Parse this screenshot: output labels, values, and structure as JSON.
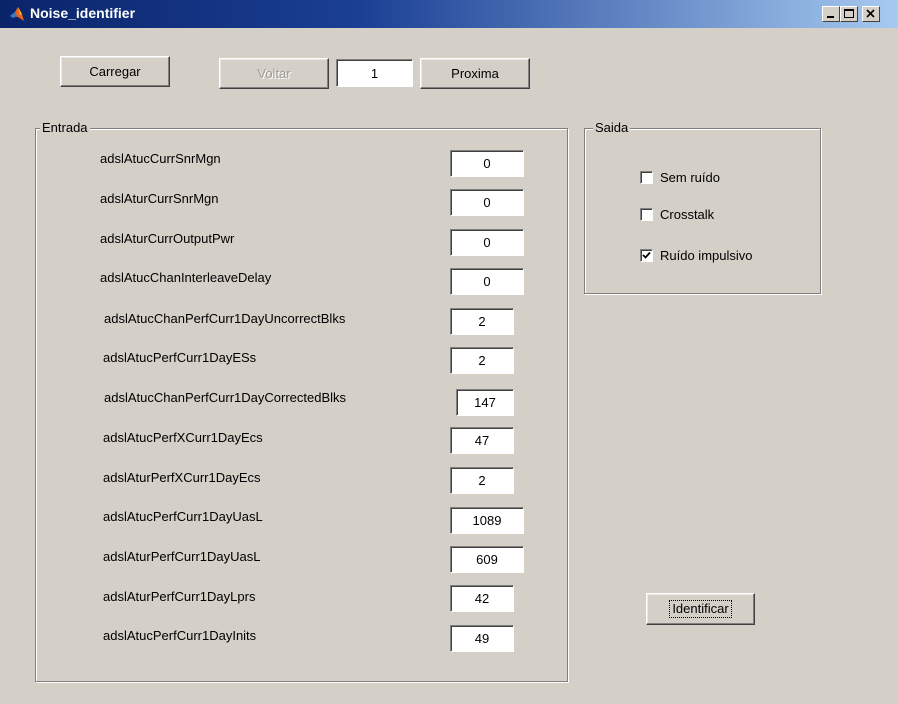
{
  "window": {
    "title": "Noise_identifier",
    "app_icon": "matlab-icon",
    "controls": [
      "minimize-icon",
      "maximize-icon",
      "close-icon"
    ]
  },
  "toolbar": {
    "load_label": "Carregar",
    "back_label": "Voltar",
    "index_value": "1",
    "next_label": "Proxima"
  },
  "entrada": {
    "title": "Entrada",
    "rows": [
      {
        "label": "adslAtucCurrSnrMgn",
        "value": "0"
      },
      {
        "label": "adslAturCurrSnrMgn",
        "value": "0"
      },
      {
        "label": "adslAturCurrOutputPwr",
        "value": "0"
      },
      {
        "label": "adslAtucChanInterleaveDelay",
        "value": "0"
      },
      {
        "label": "adslAtucChanPerfCurr1DayUncorrectBlks",
        "value": "2"
      },
      {
        "label": "adslAtucPerfCurr1DayESs",
        "value": "2"
      },
      {
        "label": "adslAtucChanPerfCurr1DayCorrectedBlks",
        "value": "147"
      },
      {
        "label": "adslAtucPerfXCurr1DayEcs",
        "value": "47"
      },
      {
        "label": "adslAturPerfXCurr1DayEcs",
        "value": "2"
      },
      {
        "label": "adslAtucPerfCurr1DayUasL",
        "value": "1089"
      },
      {
        "label": "adslAturPerfCurr1DayUasL",
        "value": "609"
      },
      {
        "label": "adslAturPerfCurr1DayLprs",
        "value": "42"
      },
      {
        "label": "adslAtucPerfCurr1DayInits",
        "value": "49"
      }
    ]
  },
  "saida": {
    "title": "Saida",
    "options": [
      {
        "label": "Sem ruído",
        "checked": false
      },
      {
        "label": "Crosstalk",
        "checked": false
      },
      {
        "label": "Ruído impulsivo",
        "checked": true
      }
    ]
  },
  "identify_label": "Identificar",
  "colors": {
    "face": "#d4d0c8",
    "title_start": "#0a246a",
    "title_end": "#a6caf0"
  }
}
